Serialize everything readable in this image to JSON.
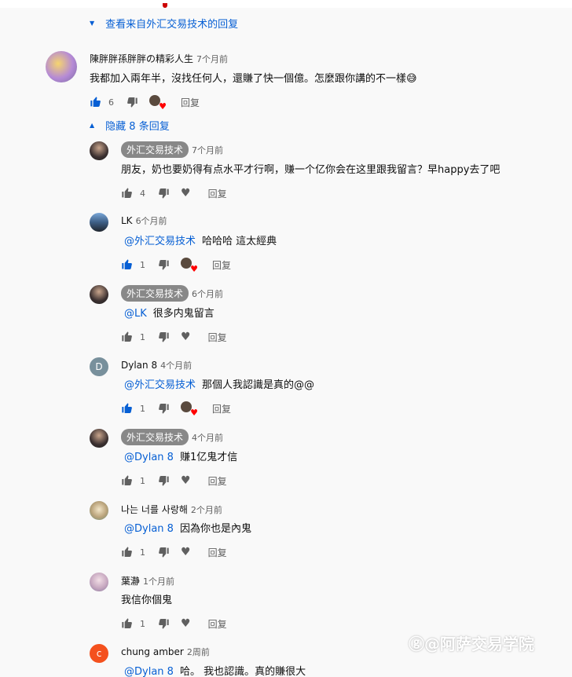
{
  "top_toggle": {
    "label": "查看来自外汇交易技术的回复"
  },
  "main_comment": {
    "author": "陳胖胖孫胖胖の精彩人生",
    "time": "7个月前",
    "text": "我都加入兩年半，沒找任何人，還賺了快一個億。怎麼跟你講的不一樣😅",
    "likes": "6",
    "reply_label": "回复"
  },
  "hide_toggle": {
    "label": "隐藏 8 条回复"
  },
  "replies": [
    {
      "author": "外汇交易技术",
      "time": "7个月前",
      "mention": "",
      "text": "朋友，奶也要奶得有点水平才行啊，赚一个亿你会在这里跟我留言？早happy去了吧",
      "likes": "4",
      "reply_label": "回复"
    },
    {
      "author": "LK",
      "time": "6个月前",
      "mention": "@外汇交易技术",
      "text": "哈哈哈 這太經典",
      "likes": "1",
      "reply_label": "回复"
    },
    {
      "author": "外汇交易技术",
      "time": "6个月前",
      "mention": "@LK",
      "text": "很多内鬼留言",
      "likes": "1",
      "reply_label": "回复"
    },
    {
      "author": "Dylan 8",
      "time": "4个月前",
      "mention": "@外汇交易技术",
      "text": "那個人我認識是真的@@",
      "likes": "1",
      "reply_label": "回复"
    },
    {
      "author": "外汇交易技术",
      "time": "4个月前",
      "mention": "@Dylan 8",
      "text": "赚1亿鬼才信",
      "likes": "1",
      "reply_label": "回复"
    },
    {
      "author": "나는 너를 사랑해",
      "time": "2个月前",
      "mention": "@Dylan 8",
      "text": "因為你也是內鬼",
      "likes": "1",
      "reply_label": "回复"
    },
    {
      "author": "葉瀞",
      "time": "1个月前",
      "mention": "",
      "text": "我信你個鬼",
      "likes": "1",
      "reply_label": "回复"
    },
    {
      "author": "chung amber",
      "time": "2周前",
      "mention": "@Dylan 8",
      "text": "哈。 我也認識。真的賺很大",
      "likes": "",
      "reply_label": ""
    }
  ],
  "avatars": {
    "dylan_letter": "D",
    "chung_letter": "c"
  },
  "watermark": "阿萨交易学院",
  "colors": {
    "link": "#065fd4",
    "channel_chip": "#888888",
    "heart": "#ff0000",
    "dylan_avatar": "#78909c",
    "chung_avatar": "#f4511e"
  }
}
